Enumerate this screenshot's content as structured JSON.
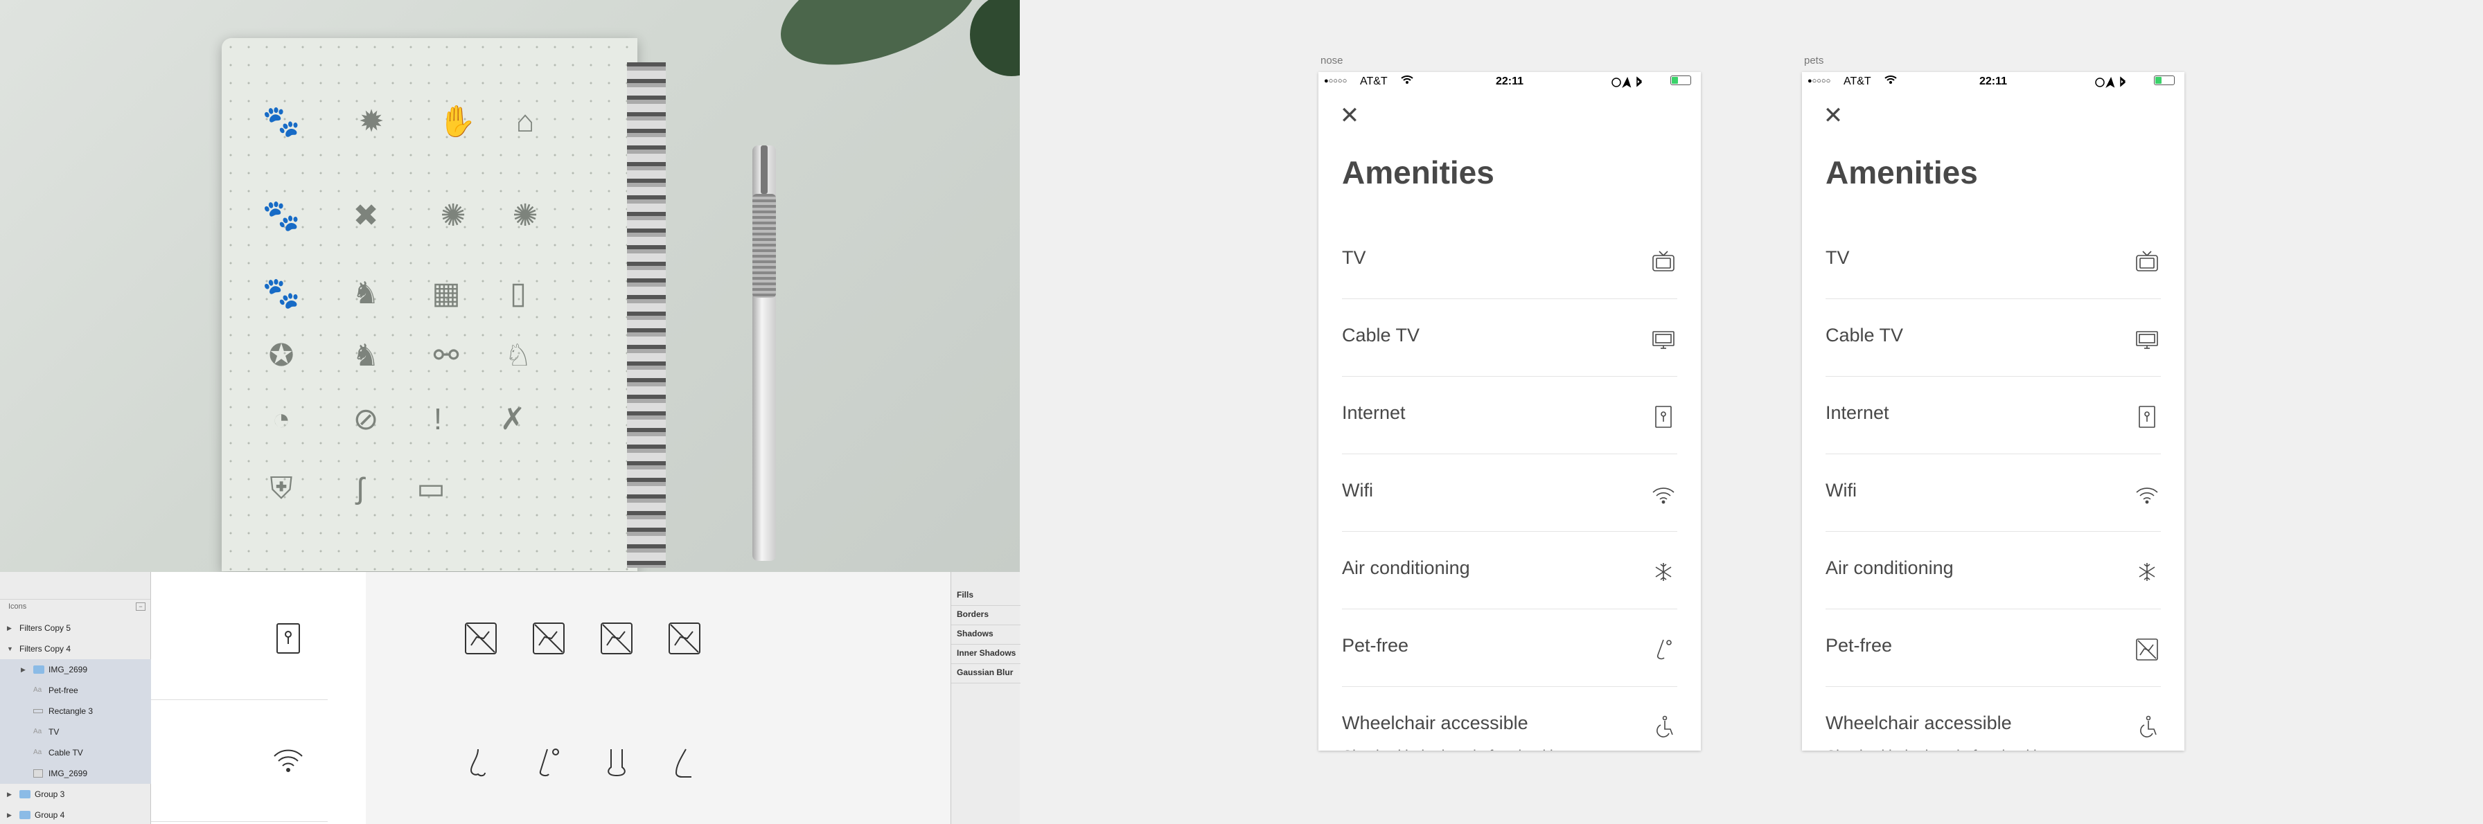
{
  "layers_panel": {
    "title": "Icons",
    "collapse_glyph": "−",
    "rows": [
      {
        "label": "Filters Copy 5",
        "kind": "folder-closed"
      },
      {
        "label": "Filters Copy 4",
        "kind": "folder-open"
      },
      {
        "label": "IMG_2699",
        "kind": "group"
      },
      {
        "label": "Pet-free",
        "kind": "text"
      },
      {
        "label": "Rectangle 3",
        "kind": "rect"
      },
      {
        "label": "TV",
        "kind": "text"
      },
      {
        "label": "Cable TV",
        "kind": "text"
      },
      {
        "label": "IMG_2699",
        "kind": "image"
      },
      {
        "label": "Group 3",
        "kind": "group"
      },
      {
        "label": "Group 4",
        "kind": "group"
      }
    ]
  },
  "inspector": {
    "sections": [
      "Fills",
      "Borders",
      "Shadows",
      "Inner Shadows",
      "Gaussian Blur"
    ]
  },
  "artboards": [
    {
      "name": "nose",
      "status": {
        "carrier": "AT&T",
        "time": "22:11",
        "signal": "●○○○○"
      },
      "close": "✕",
      "title": "Amenities",
      "items": [
        {
          "label": "TV",
          "icon": "tv-icon"
        },
        {
          "label": "Cable TV",
          "icon": "monitor-icon"
        },
        {
          "label": "Internet",
          "icon": "ethernet-jack-icon"
        },
        {
          "label": "Wifi",
          "icon": "wifi-icon"
        },
        {
          "label": "Air conditioning",
          "icon": "snowflake-icon"
        },
        {
          "label": "Pet-free",
          "icon": "nose-icon"
        },
        {
          "label": "Wheelchair accessible",
          "icon": "wheelchair-icon",
          "sub": "Check with the host before booking to"
        }
      ]
    },
    {
      "name": "pets",
      "status": {
        "carrier": "AT&T",
        "time": "22:11",
        "signal": "●○○○○"
      },
      "close": "✕",
      "title": "Amenities",
      "items": [
        {
          "label": "TV",
          "icon": "tv-icon"
        },
        {
          "label": "Cable TV",
          "icon": "monitor-icon"
        },
        {
          "label": "Internet",
          "icon": "ethernet-jack-icon"
        },
        {
          "label": "Wifi",
          "icon": "wifi-icon"
        },
        {
          "label": "Air conditioning",
          "icon": "snowflake-icon"
        },
        {
          "label": "Pet-free",
          "icon": "no-pets-icon"
        },
        {
          "label": "Wheelchair accessible",
          "icon": "wheelchair-icon",
          "sub": "Check with the host before booking to"
        }
      ]
    }
  ]
}
